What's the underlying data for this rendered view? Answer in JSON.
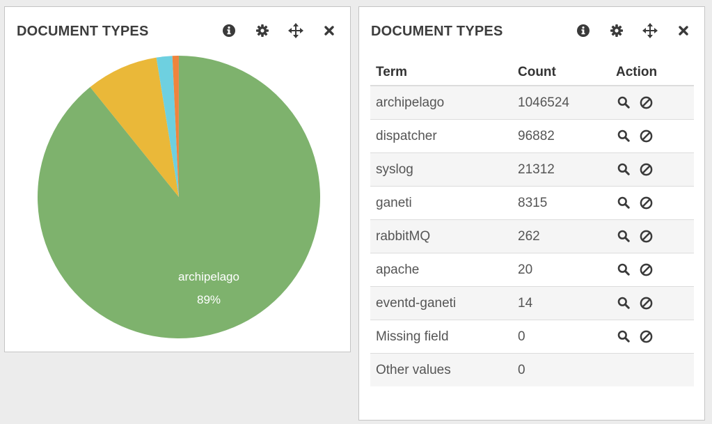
{
  "left_panel": {
    "title": "DOCUMENT TYPES",
    "tools": [
      "info-icon",
      "gear-icon",
      "move-icon",
      "close-icon"
    ]
  },
  "right_panel": {
    "title": "DOCUMENT TYPES",
    "tools": [
      "info-icon",
      "gear-icon",
      "move-icon",
      "close-icon"
    ],
    "table": {
      "headers": {
        "term": "Term",
        "count": "Count",
        "action": "Action"
      },
      "rows": [
        {
          "term": "archipelago",
          "count": "1046524",
          "actions": true
        },
        {
          "term": "dispatcher",
          "count": "96882",
          "actions": true
        },
        {
          "term": "syslog",
          "count": "21312",
          "actions": true
        },
        {
          "term": "ganeti",
          "count": "8315",
          "actions": true
        },
        {
          "term": "rabbitMQ",
          "count": "262",
          "actions": true
        },
        {
          "term": "apache",
          "count": "20",
          "actions": true
        },
        {
          "term": "eventd-ganeti",
          "count": "14",
          "actions": true
        },
        {
          "term": "Missing field",
          "count": "0",
          "actions": true
        },
        {
          "term": "Other values",
          "count": "0",
          "actions": false
        }
      ],
      "action_icons": [
        "search-icon",
        "ban-icon"
      ]
    }
  },
  "chart_data": {
    "type": "pie",
    "categories": [
      "archipelago",
      "dispatcher",
      "syslog",
      "ganeti",
      "rabbitMQ",
      "apache",
      "eventd-ganeti"
    ],
    "values": [
      1046524,
      96882,
      21312,
      8315,
      262,
      20,
      14
    ],
    "colors": [
      "#7eb26d",
      "#eab839",
      "#6ed0e0",
      "#ef843c",
      "#e24d42",
      "#1f78c1",
      "#ba43a9"
    ],
    "labels": [
      {
        "category": "archipelago",
        "text": "archipelago",
        "percent": "89%"
      }
    ]
  },
  "colors": {
    "background": "#ececec",
    "panel": "#ffffff",
    "title": "#3d3d3d",
    "icon": "#3a3a3a"
  }
}
